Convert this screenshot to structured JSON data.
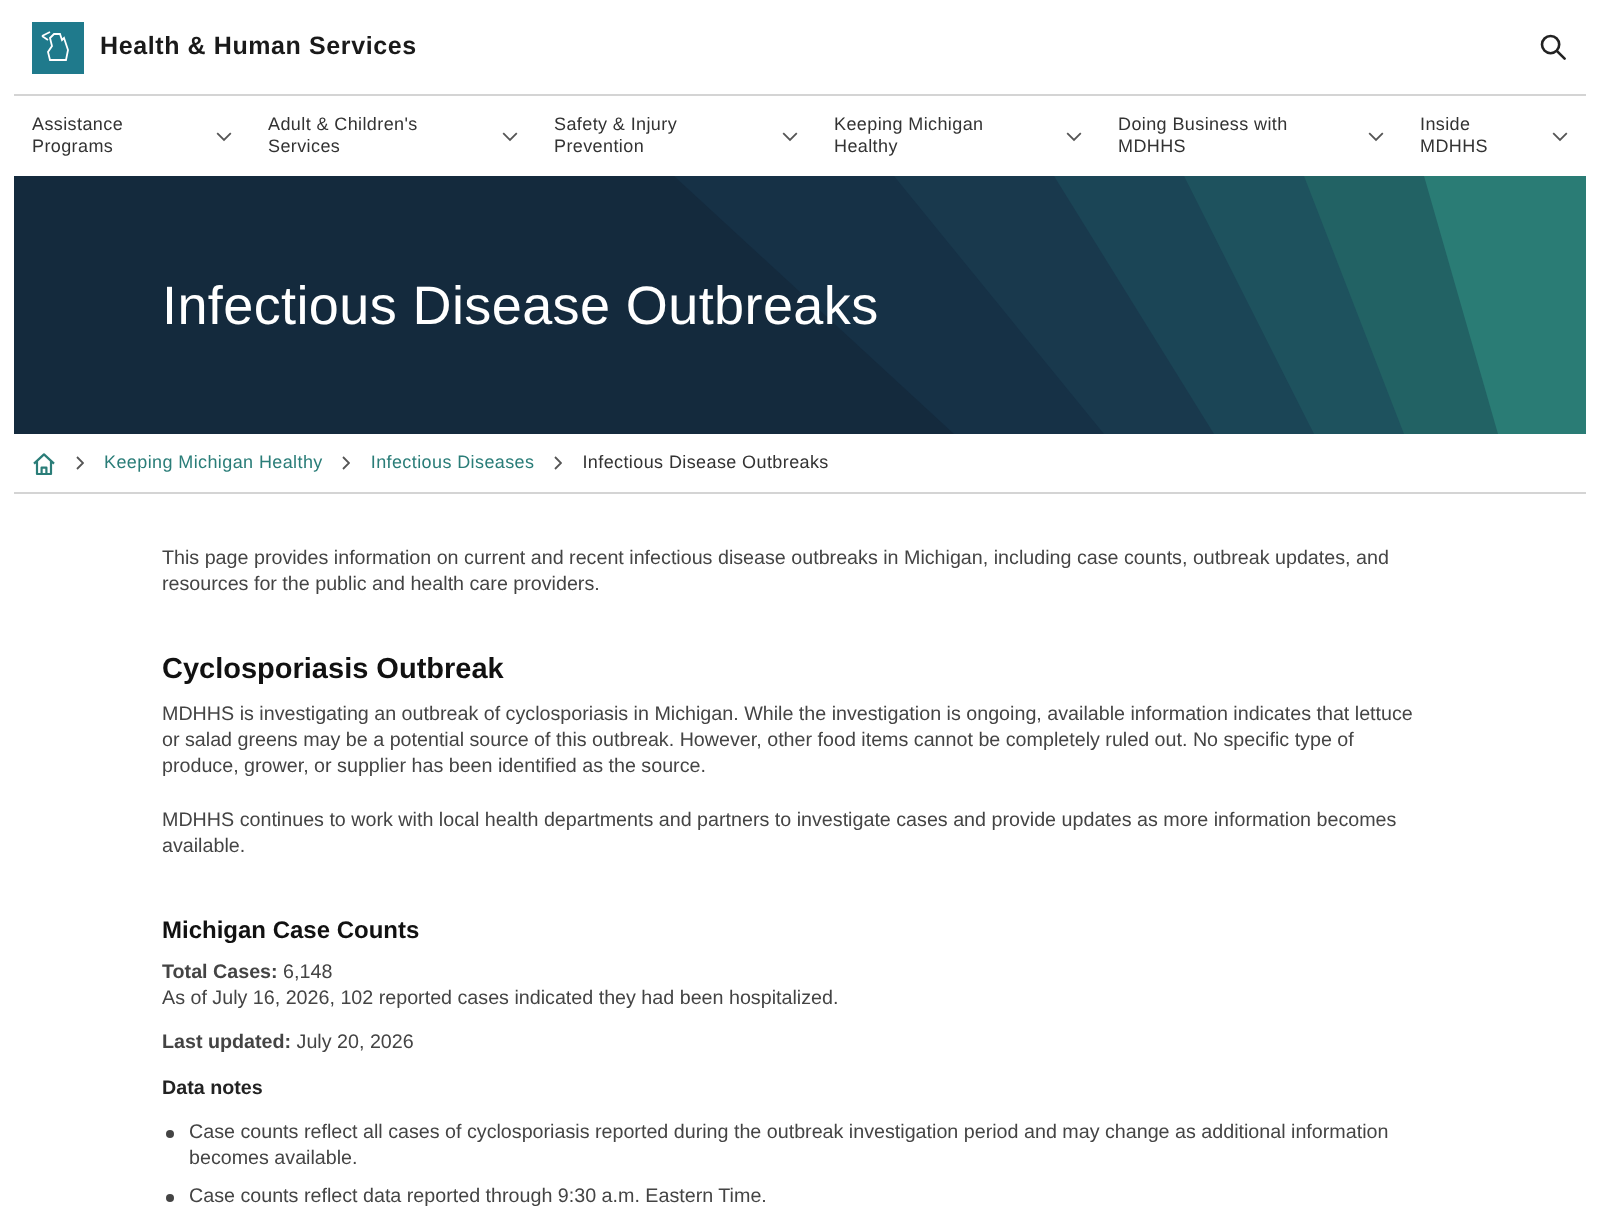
{
  "header": {
    "title": "Health & Human Services"
  },
  "nav": [
    {
      "label": "Assistance Programs"
    },
    {
      "label": "Adult & Children's Services"
    },
    {
      "label": "Safety & Injury Prevention"
    },
    {
      "label": "Keeping Michigan Healthy"
    },
    {
      "label": "Doing Business with MDHHS"
    },
    {
      "label": "Inside MDHHS"
    }
  ],
  "hero": {
    "title": "Infectious Disease Outbreaks"
  },
  "breadcrumb": [
    {
      "label": "Keeping Michigan Healthy",
      "kind": "link"
    },
    {
      "label": "Infectious Diseases",
      "kind": "link"
    },
    {
      "label": "Infectious Disease Outbreaks",
      "kind": "current"
    }
  ],
  "content": [
    {
      "kind": "paragraph",
      "text": "This page provides information on current and recent infectious disease outbreaks in Michigan, including case counts, outbreak updates, and resources for the public and health care providers."
    },
    {
      "kind": "heading",
      "text": "Cyclosporiasis Outbreak"
    },
    {
      "kind": "paragraph",
      "text": "MDHHS is investigating an outbreak of cyclosporiasis in Michigan. While the investigation is ongoing, available information indicates that lettuce or salad greens may be a potential source of this outbreak. However, other food items cannot be completely ruled out. No specific type of produce, grower, or supplier has been identified as the source."
    },
    {
      "kind": "paragraph",
      "text": "MDHHS continues to work with local health departments and partners to investigate cases and provide updates as more information becomes available."
    },
    {
      "kind": "subheading",
      "text": "Michigan Case Counts"
    },
    {
      "kind": "lines",
      "lines": [
        "**Total Cases:** 6,148",
        "As of July 16, 2026, 102 reported cases indicated they had been hospitalized."
      ]
    },
    {
      "kind": "paragraph",
      "text": "**Last updated:** July 20, 2026"
    },
    {
      "kind": "label",
      "text": "Data notes"
    },
    {
      "kind": "list",
      "items": [
        "Case counts reflect all cases of cyclosporiasis reported during the outbreak investigation period and may change as additional information becomes available.",
        "Case counts reflect data reported through 9:30 a.m. Eastern Time."
      ]
    }
  ]
}
